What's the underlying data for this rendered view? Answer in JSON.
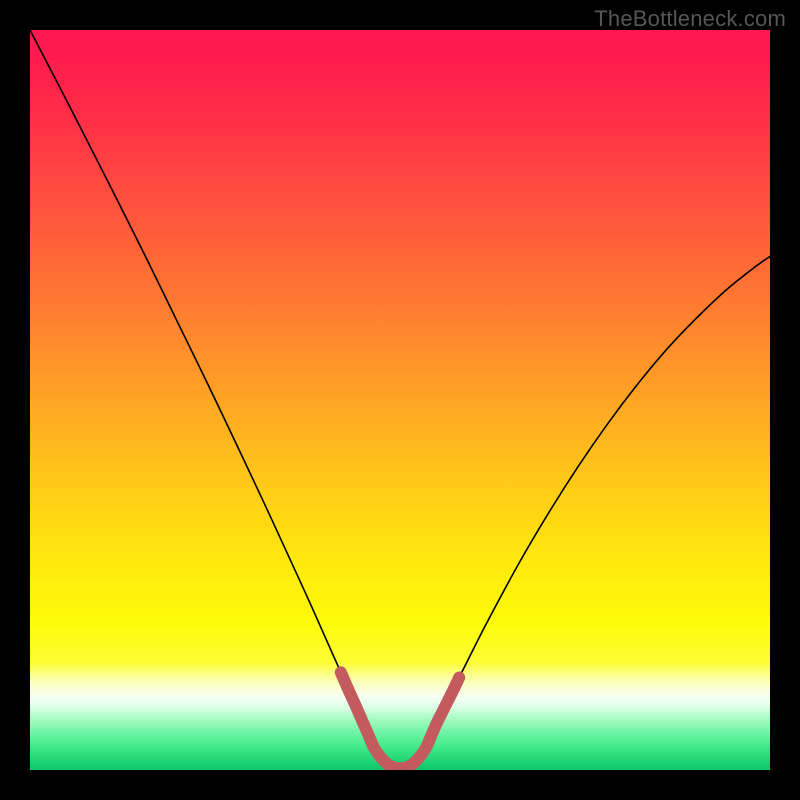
{
  "watermark": "TheBottleneck.com",
  "colors": {
    "frame": "#000000",
    "curve_stroke": "#000000",
    "band_stroke": "#c25a5e",
    "gradient_stops": [
      {
        "offset": 0.0,
        "color": "#ff1850"
      },
      {
        "offset": 0.04,
        "color": "#ff1c4d"
      },
      {
        "offset": 0.12,
        "color": "#ff2f47"
      },
      {
        "offset": 0.22,
        "color": "#ff4d3f"
      },
      {
        "offset": 0.34,
        "color": "#ff7134"
      },
      {
        "offset": 0.46,
        "color": "#ff9728"
      },
      {
        "offset": 0.58,
        "color": "#ffbf1b"
      },
      {
        "offset": 0.7,
        "color": "#ffe40f"
      },
      {
        "offset": 0.8,
        "color": "#fdfb08"
      },
      {
        "offset": 0.855,
        "color": "#fcfd35"
      },
      {
        "offset": 0.87,
        "color": "#fcfe87"
      },
      {
        "offset": 0.885,
        "color": "#fbfec8"
      },
      {
        "offset": 0.9,
        "color": "#f8fff0"
      },
      {
        "offset": 0.915,
        "color": "#dcffe8"
      },
      {
        "offset": 0.93,
        "color": "#a9fcc2"
      },
      {
        "offset": 0.945,
        "color": "#7cf7aa"
      },
      {
        "offset": 0.96,
        "color": "#55ef94"
      },
      {
        "offset": 0.975,
        "color": "#34e382"
      },
      {
        "offset": 0.99,
        "color": "#1bd271"
      },
      {
        "offset": 1.0,
        "color": "#10c666"
      }
    ]
  },
  "chart_data": {
    "type": "line",
    "title": "",
    "xlabel": "",
    "ylabel": "",
    "xlim": [
      0,
      100
    ],
    "ylim": [
      0,
      100
    ],
    "series": [
      {
        "name": "bottleneck-curve",
        "x": [
          0,
          4,
          8,
          12,
          16,
          20,
          24,
          28,
          32,
          36,
          38,
          40,
          42,
          44,
          45.5,
          47,
          48,
          50,
          52,
          53,
          54.5,
          56,
          58,
          60,
          62,
          66,
          70,
          74,
          78,
          82,
          86,
          90,
          94,
          98,
          100
        ],
        "y": [
          100,
          92.3,
          84.5,
          76.6,
          68.6,
          60.4,
          52.2,
          43.8,
          35.3,
          26.6,
          22.2,
          17.7,
          13.2,
          8.7,
          5.3,
          2.3,
          0.7,
          0.0,
          0.7,
          2.3,
          5.3,
          8.4,
          12.5,
          16.5,
          20.4,
          27.8,
          34.6,
          40.9,
          46.7,
          52.0,
          56.8,
          61.0,
          64.8,
          68.0,
          69.4
        ]
      },
      {
        "name": "optimal-band",
        "x": [
          42.0,
          43.0,
          44.0,
          45.0,
          45.8,
          46.5,
          47.5,
          49.0,
          51.0,
          52.5,
          53.5,
          54.2,
          55.0,
          56.0,
          57.0,
          58.0
        ],
        "y": [
          13.2,
          10.9,
          8.7,
          6.4,
          4.6,
          3.0,
          1.6,
          0.4,
          0.4,
          1.6,
          3.0,
          4.6,
          6.4,
          8.4,
          10.4,
          12.5
        ]
      }
    ],
    "annotations": [
      {
        "text": "TheBottleneck.com",
        "position": "top-right"
      }
    ]
  }
}
